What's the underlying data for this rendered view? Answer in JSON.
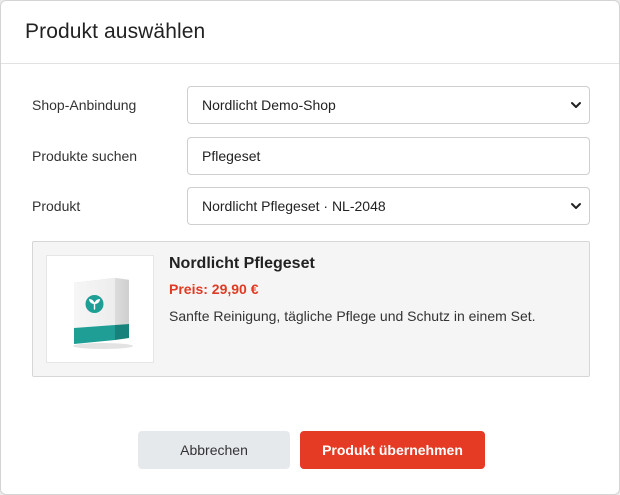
{
  "dialog": {
    "title": "Produkt auswählen"
  },
  "form": {
    "shop": {
      "label": "Shop-Anbindung",
      "value": "Nordlicht Demo-Shop"
    },
    "search": {
      "label": "Produkte suchen",
      "value": "Pflegeset"
    },
    "product": {
      "label": "Produkt",
      "value": "Nordlicht Pflegeset · NL-2048"
    }
  },
  "preview": {
    "name": "Nordlicht Pflegeset",
    "price": "Preis: 29,90 €",
    "description": "Sanfte Reinigung, tägliche Pflege und Schutz in einem Set.",
    "image_icon": "leaf-icon",
    "colors": {
      "price": "#e03a24",
      "box_accent": "#1f9e96"
    }
  },
  "actions": {
    "cancel_label": "Abbrechen",
    "apply_label": "Produkt übernehmen",
    "colors": {
      "primary": "#e53a24",
      "secondary": "#e6e9ec"
    }
  }
}
